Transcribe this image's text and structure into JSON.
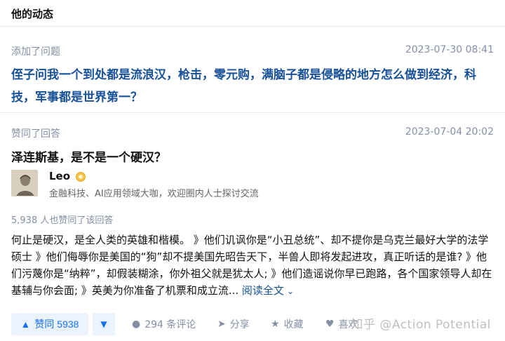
{
  "header": {
    "title": "他的动态"
  },
  "activity1": {
    "action": "添加了问题",
    "time": "2023-07-30 08:41",
    "question": "侄子问我一个到处都是流浪汉，枪击，零元购，满脑子都是侵略的地方怎么做到经济，科技，军事都是世界第一？"
  },
  "activity2": {
    "action": "赞同了回答",
    "time": "2023-07-04 20:02",
    "title": "泽连斯基，是不是一个硬汉？",
    "author": {
      "name": "Leo",
      "bio": "金融科技、AI应用领域大咖，欢迎圈内人士探讨交流"
    },
    "likes_note": "5,938 人也赞同了该回答",
    "content": "何止是硬汉，是全人类的英雄和楷模。 》他们讥讽你是“小丑总统”、却不提你是乌克兰最好大学的法学硕士 》他们侮辱你是美国的“狗”却不提美国先昭告天下，半兽人即将发起进攻，真正听话的是谁? 》他们污蔑你是“纳粹”，却假装糊涂，你外祖父就是犹太人; 》他们造谣说你早已跑路，各个国家领导人却在基辅与你会面; 》英美为你准备了机票和成立流...",
    "read_more": "阅读全文",
    "actions": {
      "vote_up": "赞同 5938",
      "comments": "294 条评论",
      "share": "分享",
      "favorite": "收藏",
      "like": "喜欢"
    }
  },
  "watermark": "知乎 @Action Potential",
  "colors": {
    "link_blue": "#175199",
    "accent_blue": "#1772f6",
    "meta_gray": "#8590a6"
  },
  "icons": [
    "triangle-up-icon",
    "triangle-down-icon",
    "comment-icon",
    "share-icon",
    "favorite-icon",
    "heart-icon",
    "chevron-down-icon",
    "badge-icon"
  ]
}
